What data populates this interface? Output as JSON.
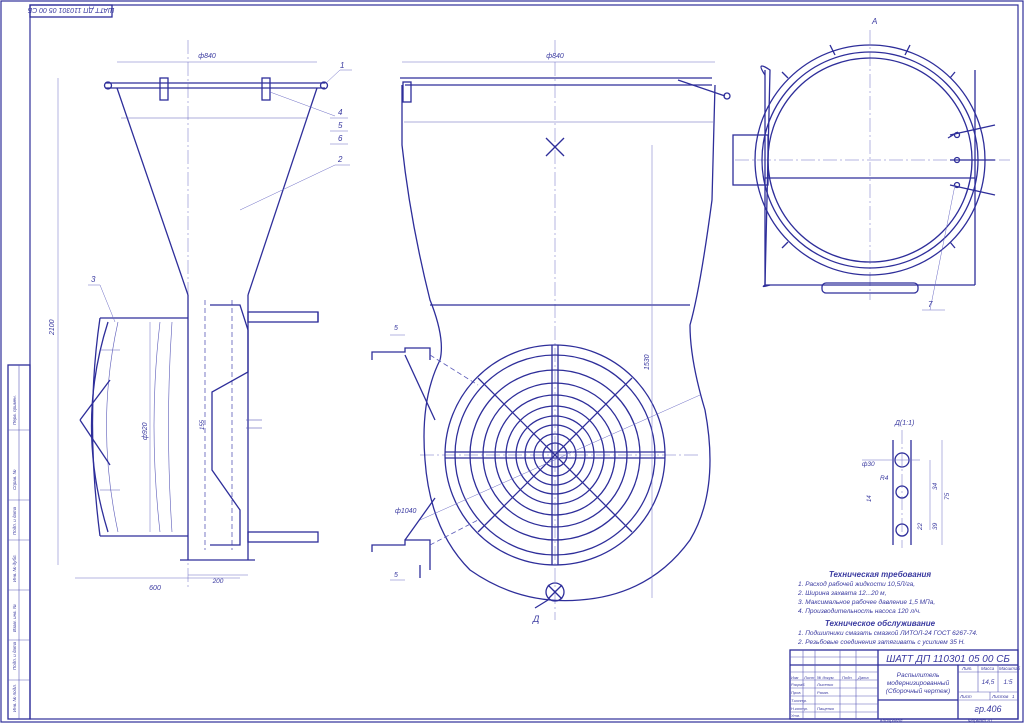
{
  "stamp_top_rotated": "ШАТТ ДП 110301 05 00 СБ",
  "view_labels": {
    "section_a": "А",
    "detail_d": "Д",
    "detail_view": "Д(1:1)"
  },
  "dimensions": {
    "side_top_width": "ф840",
    "front_top_width": "ф840",
    "height_total": "2100",
    "side_base_width": "600",
    "side_neck_width": "200",
    "drum_diameter": "ф920",
    "pipe_small": "155",
    "front_height": "1530",
    "wheel_diameter": "ф1040",
    "offset_top": "5",
    "offset_bottom": "5",
    "detail_d30": "ф30",
    "detail_r4": "R4",
    "detail_34": "34",
    "detail_22": "22",
    "detail_39": "39",
    "detail_75": "75",
    "detail_14": "14"
  },
  "callouts": [
    "1",
    "2",
    "3",
    "4",
    "5",
    "6",
    "7"
  ],
  "requirements": {
    "title": "Техническая требования",
    "items": [
      "1. Расход рабочей жидкости 10,5Л/га,",
      "2. Ширина захвата 12...20 м,",
      "3. Максимальное рабочее давление 1,5 МПа,",
      "4. Производительность насоса 120 л/ч."
    ]
  },
  "maintenance": {
    "title": "Техническое обслуживание",
    "items": [
      "1. Подшипники смазать смазкой ЛИТОЛ-24 ГОСТ 6267-74.",
      "2. Резьбовые соединения затягивать с усилием 35 Н."
    ]
  },
  "title_block": {
    "designation": "ШАТТ ДП 110301 05 00 СБ",
    "name_line1": "Распылитель",
    "name_line2": "модернизированный",
    "name_line3": "(Сборочный чертеж)",
    "mass": "14,5",
    "scale": "1:5",
    "group": "гр.406",
    "sheet": "Лист",
    "sheets": "Листов",
    "sheets_num": "1",
    "copied": "Копировал",
    "format": "Формат А1",
    "col_izm": "Изм",
    "col_list": "Лист",
    "col_doc": "№ докум.",
    "col_sign": "Подп.",
    "col_date": "Дата",
    "row_razrab": "Разраб.",
    "row_prov": "Пров.",
    "row_tkontr": "Т.контр.",
    "row_nkontr": "Н.контр.",
    "row_utv": "Утв.",
    "name_razrab": "Лысенко",
    "name_prov": "Рязан.",
    "name_utv": "Пащенко",
    "hdr_lit": "Лит.",
    "hdr_mass": "Масса",
    "hdr_scale": "Масштаб"
  },
  "side_stamp": [
    "Инв. № подл.",
    "Подп. и дата",
    "Взам. инв. №",
    "Инв. № дубл.",
    "Подп. и дата",
    "Справ. №",
    "Перв. примен."
  ]
}
